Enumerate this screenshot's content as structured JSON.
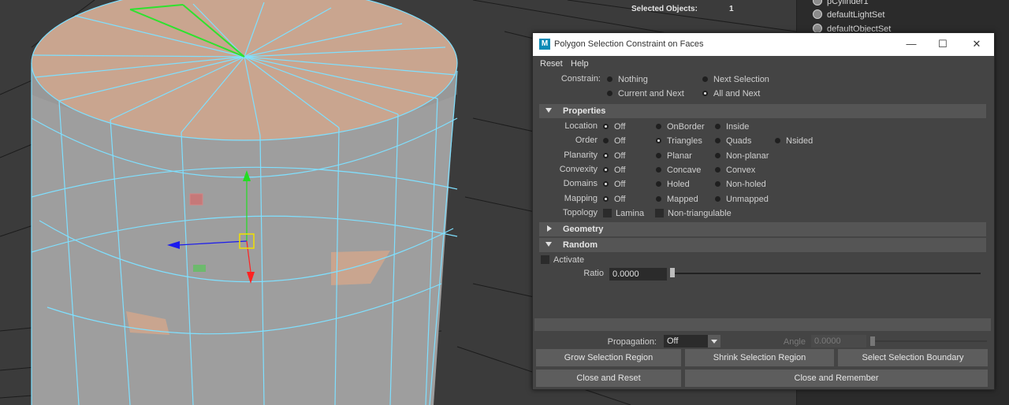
{
  "viewport": {
    "hud_label": "Selected Objects:",
    "hud_value": "1",
    "colors": {
      "wire": "#7fe0ff",
      "face_selected": "#c8a08a",
      "edge_highlight": "#2ee22e",
      "manip_y": "#22dd22",
      "manip_x": "#ff2222",
      "manip_z": "#1a1aee"
    }
  },
  "outliner": {
    "items": [
      {
        "label": "pCylinder1",
        "icon": "mesh-icon"
      },
      {
        "label": "defaultLightSet",
        "icon": "set-icon"
      },
      {
        "label": "defaultObjectSet",
        "icon": "set-icon"
      }
    ]
  },
  "dialog": {
    "title": "Polygon Selection Constraint on Faces",
    "logo": "M",
    "window_buttons": {
      "minimize": "—",
      "maximize": "☐",
      "close": "✕"
    },
    "menus": [
      "Reset",
      "Help"
    ],
    "constrain": {
      "label": "Constrain:",
      "options": [
        "Nothing",
        "Next Selection",
        "Current and Next",
        "All and Next"
      ],
      "selected": "All and Next"
    },
    "properties": {
      "title": "Properties",
      "rows": [
        {
          "label": "Location",
          "options": [
            "Off",
            "OnBorder",
            "Inside"
          ],
          "selected": "Off"
        },
        {
          "label": "Order",
          "options": [
            "Off",
            "Triangles",
            "Quads",
            "Nsided"
          ],
          "selected": "Triangles"
        },
        {
          "label": "Planarity",
          "options": [
            "Off",
            "Planar",
            "Non-planar"
          ],
          "selected": "Off"
        },
        {
          "label": "Convexity",
          "options": [
            "Off",
            "Concave",
            "Convex"
          ],
          "selected": "Off"
        },
        {
          "label": "Domains",
          "options": [
            "Off",
            "Holed",
            "Non-holed"
          ],
          "selected": "Off"
        },
        {
          "label": "Mapping",
          "options": [
            "Off",
            "Mapped",
            "Unmapped"
          ],
          "selected": "Off"
        }
      ],
      "topology": {
        "label": "Topology",
        "checks": [
          "Lamina",
          "Non-triangulable"
        ]
      }
    },
    "geometry": {
      "title": "Geometry"
    },
    "random": {
      "title": "Random",
      "activate_label": "Activate",
      "ratio_label": "Ratio",
      "ratio_value": "0.0000",
      "ratio_slider_fraction": 0.0
    },
    "propagation": {
      "label": "Propagation:",
      "value": "Off",
      "angle_label": "Angle",
      "angle_value": "0.0000"
    },
    "buttons": {
      "grow": "Grow Selection Region",
      "shrink": "Shrink Selection Region",
      "select_boundary": "Select Selection Boundary",
      "close_reset": "Close and Reset",
      "close_remember": "Close and Remember"
    }
  }
}
